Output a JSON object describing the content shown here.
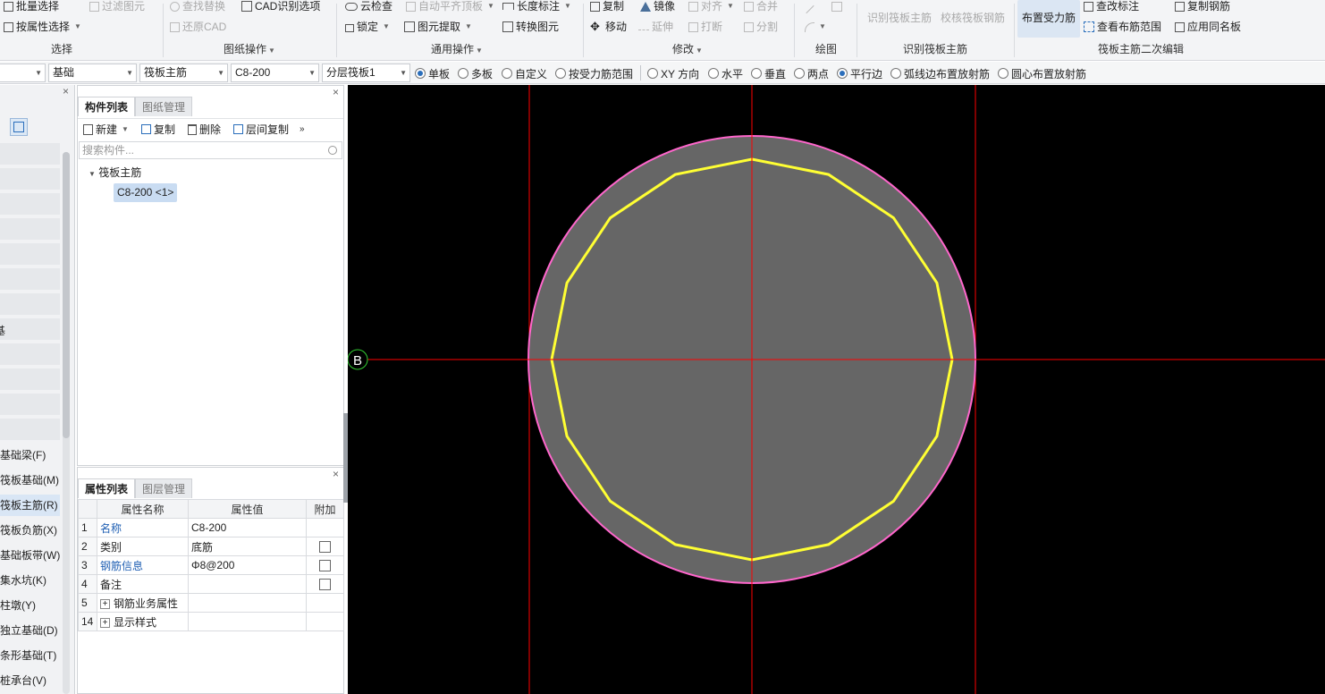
{
  "ribbon": {
    "select": {
      "batch_select": "批量选择",
      "filter_elements": "过滤图元",
      "select_by_attr": "按属性选择",
      "group_label": "选择"
    },
    "drawing": {
      "find_replace": "查找替换",
      "cad_options": "CAD识别选项",
      "restore_cad": "还原CAD",
      "group_label": "图纸操作"
    },
    "general": {
      "cloud_check": "云检查",
      "auto_flush_top": "自动平齐顶板",
      "length_dim": "长度标注",
      "lock": "锁定",
      "extract_element": "图元提取",
      "convert_element": "转换图元",
      "group_label": "通用操作"
    },
    "modify": {
      "copy": "复制",
      "mirror": "镜像",
      "align": "对齐",
      "merge": "合并",
      "move": "移动",
      "extend": "延伸",
      "break": "打断",
      "split": "分割",
      "group_label": "修改"
    },
    "draw": {
      "group_label": "绘图"
    },
    "identify": {
      "identify_main": "识别筏板主筋",
      "check_main": "校核筏板钢筋",
      "group_label": "识别筏板主筋"
    },
    "secondary": {
      "place_rebar": "布置受力筋",
      "modify_label": "查改标注",
      "copy_rebar": "复制钢筋",
      "view_range": "查看布筋范围",
      "apply_same": "应用同名板",
      "group_label": "筏板主筋二次编辑"
    }
  },
  "toolbar2": {
    "combos": [
      "",
      "基础",
      "筏板主筋",
      "C8-200",
      "分层筏板1"
    ],
    "radios": [
      {
        "label": "单板",
        "checked": true
      },
      {
        "label": "多板",
        "checked": false
      },
      {
        "label": "自定义",
        "checked": false
      },
      {
        "label": "按受力筋范围",
        "checked": false
      },
      {
        "label": "XY 方向",
        "checked": false
      },
      {
        "label": "水平",
        "checked": false
      },
      {
        "label": "垂直",
        "checked": false
      },
      {
        "label": "两点",
        "checked": false
      },
      {
        "label": "平行边",
        "checked": true
      },
      {
        "label": "弧线边布置放射筋",
        "checked": false
      },
      {
        "label": "圆心布置放射筋",
        "checked": false
      }
    ]
  },
  "nav": {
    "close": "×",
    "trunc_char": "基",
    "items": [
      {
        "label": "基础梁(F)",
        "selected": false
      },
      {
        "label": "筏板基础(M)",
        "selected": false
      },
      {
        "label": "筏板主筋(R)",
        "selected": true
      },
      {
        "label": "筏板负筋(X)",
        "selected": false
      },
      {
        "label": "基础板带(W)",
        "selected": false
      },
      {
        "label": "集水坑(K)",
        "selected": false
      },
      {
        "label": "柱墩(Y)",
        "selected": false
      },
      {
        "label": "独立基础(D)",
        "selected": false
      },
      {
        "label": "条形基础(T)",
        "selected": false
      },
      {
        "label": "桩承台(V)",
        "selected": false
      }
    ]
  },
  "component_list": {
    "tab_active": "构件列表",
    "tab_other": "图纸管理",
    "close": "×",
    "new": "新建",
    "copy": "复制",
    "delete": "删除",
    "layer_copy": "层间复制",
    "more": "»",
    "search_placeholder": "搜索构件...",
    "tree_root": "筏板主筋",
    "tree_leaf": "C8-200 <1>"
  },
  "properties": {
    "tab_active": "属性列表",
    "tab_other": "图层管理",
    "close": "×",
    "headers": [
      "属性名称",
      "属性值",
      "附加"
    ],
    "rows": [
      {
        "num": "1",
        "name": "名称",
        "value": "C8-200",
        "blue": true,
        "check": false
      },
      {
        "num": "2",
        "name": "类别",
        "value": "底筋",
        "blue": false,
        "check": true
      },
      {
        "num": "3",
        "name": "钢筋信息",
        "value": "Φ8@200",
        "blue": true,
        "check": true
      },
      {
        "num": "4",
        "name": "备注",
        "value": "",
        "blue": false,
        "check": true
      },
      {
        "num": "5",
        "name": "钢筋业务属性",
        "value": "",
        "blue": false,
        "check": false,
        "expand": true
      },
      {
        "num": "14",
        "name": "显示样式",
        "value": "",
        "blue": false,
        "check": false,
        "expand": true
      }
    ]
  },
  "canvas": {
    "axis_label": "B",
    "colors": {
      "background": "#000000",
      "slab": "#666666",
      "slab_edge": "#ff66cc",
      "rebar": "#ffff33",
      "axis": "#ff0000",
      "axis_bubble": "#33cc33"
    }
  }
}
